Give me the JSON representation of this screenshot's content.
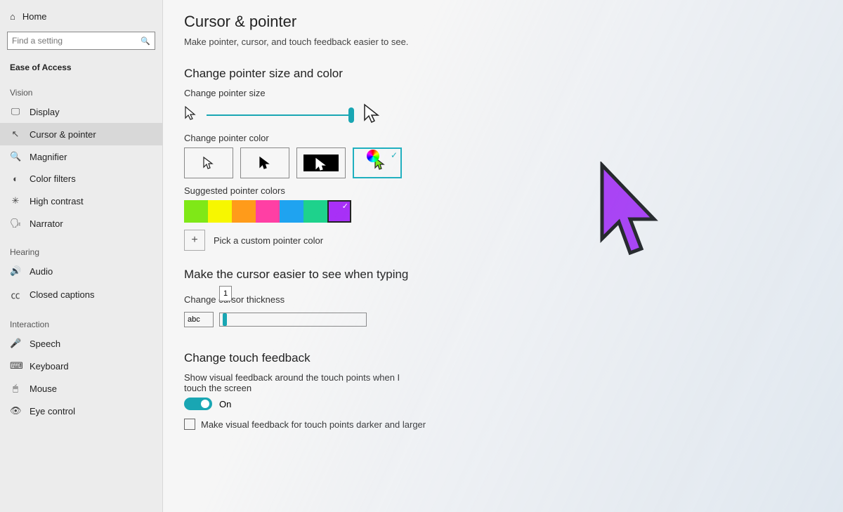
{
  "sidebar": {
    "home": "Home",
    "search_placeholder": "Find a setting",
    "section": "Ease of Access",
    "groups": [
      {
        "label": "Vision",
        "items": [
          {
            "icon": "🖵",
            "label": "Display"
          },
          {
            "icon": "↖",
            "label": "Cursor & pointer",
            "active": true
          },
          {
            "icon": "🔍",
            "label": "Magnifier"
          },
          {
            "icon": "◐",
            "label": "Color filters"
          },
          {
            "icon": "✳",
            "label": "High contrast"
          },
          {
            "icon": "🗣",
            "label": "Narrator"
          }
        ]
      },
      {
        "label": "Hearing",
        "items": [
          {
            "icon": "🔊",
            "label": "Audio"
          },
          {
            "icon": "㏄",
            "label": "Closed captions"
          }
        ]
      },
      {
        "label": "Interaction",
        "items": [
          {
            "icon": "🎤",
            "label": "Speech"
          },
          {
            "icon": "⌨",
            "label": "Keyboard"
          },
          {
            "icon": "🖱",
            "label": "Mouse"
          },
          {
            "icon": "👁",
            "label": "Eye control"
          }
        ]
      }
    ]
  },
  "page": {
    "title": "Cursor & pointer",
    "subtitle": "Make pointer, cursor, and touch feedback easier to see."
  },
  "pointer_section": {
    "heading": "Change pointer size and color",
    "size_label": "Change pointer size",
    "size_position_pct": 98,
    "color_label": "Change pointer color",
    "color_options": [
      {
        "id": "white"
      },
      {
        "id": "black"
      },
      {
        "id": "inverted"
      },
      {
        "id": "custom",
        "selected": true
      }
    ],
    "suggested_label": "Suggested pointer colors",
    "swatches": [
      {
        "hex": "#7FE817"
      },
      {
        "hex": "#F7F700"
      },
      {
        "hex": "#FF9B1A"
      },
      {
        "hex": "#FF3FA4"
      },
      {
        "hex": "#1FA3F0"
      },
      {
        "hex": "#1ED28C"
      },
      {
        "hex": "#A830F7",
        "selected": true
      }
    ],
    "custom_label": "Pick a custom pointer color"
  },
  "cursor_section": {
    "heading": "Make the cursor easier to see when typing",
    "thickness_label": "Change cursor thickness",
    "abc_preview": "abc",
    "thickness_value": "1"
  },
  "touch_section": {
    "heading": "Change touch feedback",
    "show_label": "Show visual feedback around the touch points when I touch the screen",
    "toggle_state": "On",
    "checkbox_label": "Make visual feedback for touch points darker and larger"
  },
  "accent": "#A830F7"
}
